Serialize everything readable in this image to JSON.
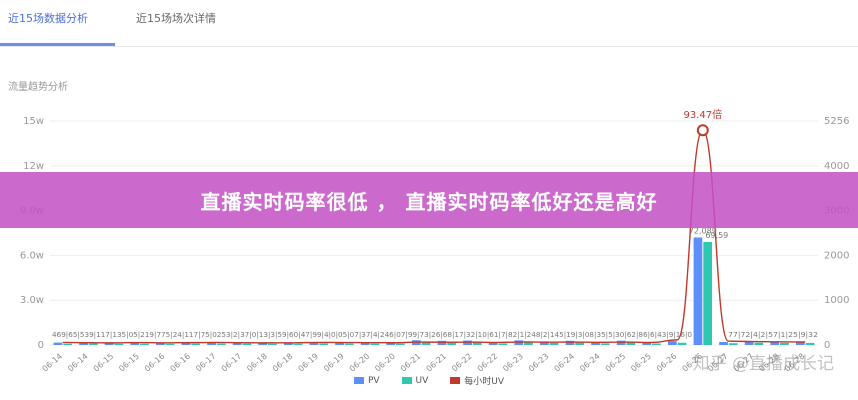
{
  "tabs": [
    {
      "label": "近15场数据分析",
      "active": true
    },
    {
      "label": "近15场场次详情",
      "active": false
    }
  ],
  "section_title": "流量趋势分析",
  "banner_text": "直播实时码率很低 ， 直播实时码率低好还是高好",
  "watermark": "知乎 @直播成长记",
  "colors": {
    "pv": "#5b8ff9",
    "uv": "#2ec7b0",
    "per_hour_uv": "#c0392b",
    "banner": "#c450c4"
  },
  "chart_data": {
    "type": "bar",
    "left_axis": {
      "ticks": [
        "0",
        "3.0w",
        "6.0w",
        "9.0w",
        "12w",
        "15w"
      ],
      "ylim": [
        0,
        150000
      ]
    },
    "right_axis": {
      "ticks": [
        "0",
        "1000",
        "2000",
        "3000",
        "4000",
        "5256"
      ],
      "ylim": [
        0,
        5256
      ]
    },
    "categories": [
      "06-14",
      "06-14",
      "06-15",
      "06-15",
      "06-16",
      "06-16",
      "06-17",
      "06-17",
      "06-18",
      "06-18",
      "06-19",
      "06-19",
      "06-20",
      "06-20",
      "06-21",
      "06-21",
      "06-22",
      "06-22",
      "06-23",
      "06-23",
      "06-24",
      "06-24",
      "06-25",
      "06-25",
      "06-26",
      "06-26",
      "06-27",
      "06-27",
      "06-28",
      "06-28"
    ],
    "series": [
      {
        "name": "PV",
        "axis": "left",
        "values": [
          1600,
          1700,
          1500,
          1600,
          1400,
          1500,
          1700,
          1600,
          1500,
          1400,
          1800,
          1700,
          1600,
          1500,
          3200,
          2800,
          3000,
          1800,
          3100,
          2400,
          2800,
          1900,
          2900,
          1800,
          2600,
          72000,
          2000,
          2600,
          2400,
          2500
        ]
      },
      {
        "name": "UV",
        "axis": "left",
        "values": [
          900,
          1000,
          800,
          900,
          800,
          900,
          1000,
          900,
          800,
          800,
          1100,
          1000,
          900,
          900,
          2000,
          1600,
          1800,
          1000,
          1800,
          1400,
          1600,
          1100,
          1700,
          1000,
          1500,
          69000,
          1200,
          1500,
          1400,
          1400
        ]
      },
      {
        "name": "每小时UV",
        "axis": "right",
        "values": [
          60,
          55,
          50,
          58,
          52,
          56,
          60,
          55,
          50,
          52,
          60,
          58,
          55,
          53,
          70,
          65,
          68,
          60,
          72,
          66,
          70,
          62,
          68,
          60,
          120,
          5040,
          90,
          80,
          75,
          70
        ]
      }
    ],
    "peak_annotation": "93.47倍",
    "data_labels_left": "469|65|539|117|135|05|219|775|24|117|75|0253|2|37|0|13|3|59|60|47|99|4|0|05|07|37|4|246|07|99|73|26|68|17|32|10|61|7|82|1|248|2|145|19|3|08|35|5|30|62|86|6|43|9|16|0",
    "data_labels_right": "77|72|4|2|57|1|25|9|32",
    "data_labels_bar_top": "72,089",
    "data_labels_bar_top2": "69,59",
    "legend": [
      "PV",
      "UV",
      "每小时UV"
    ]
  }
}
